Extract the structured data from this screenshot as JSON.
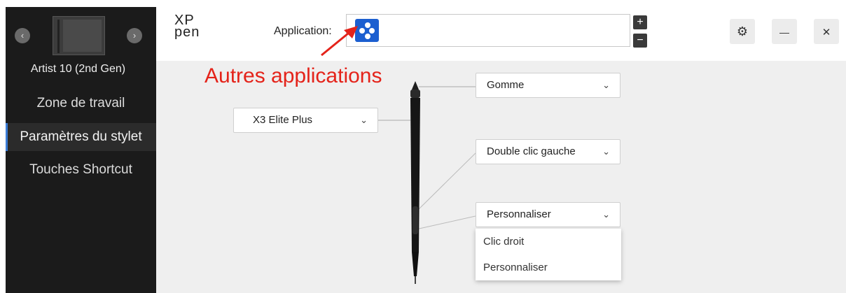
{
  "sidebar": {
    "prev_icon": "‹",
    "next_icon": "›",
    "device_name": "Artist 10 (2nd Gen)",
    "items": [
      {
        "label": "Zone de travail"
      },
      {
        "label": "Paramètres du stylet"
      },
      {
        "label": "Touches Shortcut"
      }
    ]
  },
  "header": {
    "logo": "XP\npen",
    "application_label": "Application:",
    "plus": "+",
    "minus": "−",
    "settings_icon": "⚙",
    "minimize_icon": "—",
    "close_icon": "✕"
  },
  "annotation": {
    "text": "Autres applications",
    "color": "#e4231a"
  },
  "pen": {
    "model_dropdown": {
      "value": "X3 Elite Plus"
    },
    "eraser_dropdown": {
      "value": "Gomme"
    },
    "upper_button_dropdown": {
      "value": "Double clic gauche"
    },
    "lower_button_dropdown": {
      "value": "Personnaliser"
    },
    "open_menu": [
      {
        "label": "Clic droit"
      },
      {
        "label": "Personnaliser"
      }
    ]
  },
  "colors": {
    "sidebar_bg": "#1b1b1b",
    "accent": "#1c5fd0",
    "annotation": "#e4231a"
  }
}
